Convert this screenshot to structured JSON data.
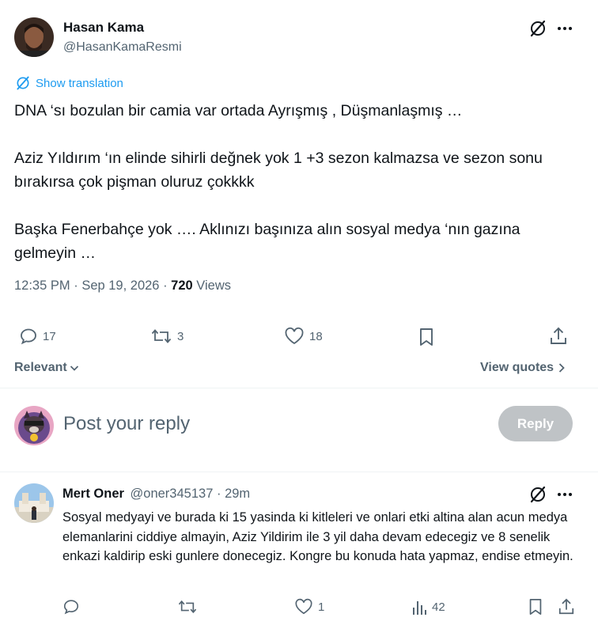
{
  "tweet": {
    "author_name": "Hasan Kama",
    "author_handle": "@HasanKamaResmi",
    "show_translation": "Show translation",
    "paragraphs": [
      "DNA ‘sı bozulan bir camia var ortada Ayrışmış , Düşmanlaşmış …",
      "Aziz Yıldırım ‘ın elinde sihirli değnek yok 1 +3 sezon kalmazsa ve sezon sonu bırakırsa çok pişman oluruz çokkkk",
      "Başka Fenerbahçe yok …. Aklınızı başınıza alın sosyal medya ‘nın gazına gelmeyin …"
    ],
    "time": "12:35 PM",
    "date": "Sep 19, 2026",
    "views_count": "720",
    "views_label": "Views",
    "replies": "17",
    "reposts": "3",
    "likes": "18"
  },
  "sort": {
    "label": "Relevant",
    "view_quotes": "View quotes"
  },
  "composer": {
    "placeholder": "Post your reply",
    "button": "Reply"
  },
  "reply": {
    "author_name": "Mert Oner",
    "author_handle": "@oner345137",
    "time": "29m",
    "text": "Sosyal medyayi ve burada ki 15 yasinda ki kitleleri ve onlari etki altina alan acun medya elemanlarini ciddiye almayin, Aziz Yildirim ile 3 yil daha devam edecegiz ve 8 senelik enkazi kaldirip eski gunlere donecegiz. Kongre bu konuda hata yapmaz, endise etmeyin.",
    "likes": "1",
    "views": "42"
  },
  "colors": {
    "accent": "#1d9bf0",
    "muted": "#536471",
    "reply_button_disabled": "#8ecdf8",
    "divider": "#eff3f4"
  }
}
